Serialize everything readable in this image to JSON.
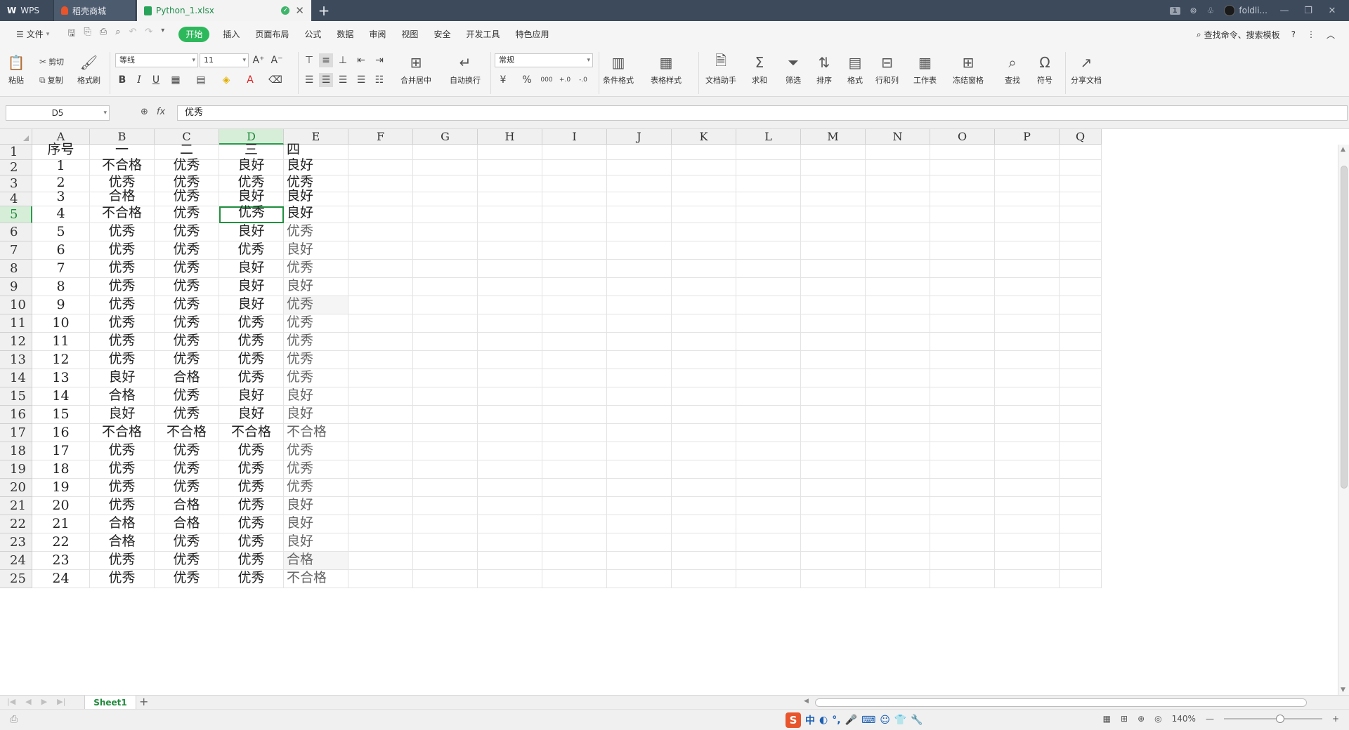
{
  "titlebar": {
    "tabs": [
      {
        "label": "WPS",
        "icon": "wps-logo-icon"
      },
      {
        "label": "稻壳商城",
        "icon": "docer-flame-icon"
      },
      {
        "label": "Python_1.xlsx",
        "icon": "spreadsheet-icon",
        "active": true
      }
    ],
    "new_tab": "+",
    "badge": "1",
    "user": "foldli...",
    "win_buttons": [
      "—",
      "❐",
      "✕"
    ]
  },
  "menubar": {
    "file": "文件",
    "items": [
      "开始",
      "插入",
      "页面布局",
      "公式",
      "数据",
      "审阅",
      "视图",
      "安全",
      "开发工具",
      "特色应用"
    ],
    "active": "开始",
    "search": "查找命令、搜索模板",
    "help": "?",
    "more": "⋮",
    "collapse": "︿"
  },
  "ribbon": {
    "paste": "粘贴",
    "cut": "剪切",
    "copy": "复制",
    "format_painter": "格式刷",
    "font_name": "等线",
    "font_size": "11",
    "grow": "A⁺",
    "shrink": "A⁻",
    "bold": "B",
    "italic": "I",
    "underline": "U",
    "merge_center": "合并居中",
    "wrap": "自动换行",
    "number_format": "常规",
    "percent": "%",
    "thousands": "000",
    "inc_decimal": "+.0",
    "dec_decimal": "-.0",
    "cond_format": "条件格式",
    "table_style": "表格样式",
    "doc_helper": "文档助手",
    "sum": "求和",
    "filter": "筛选",
    "sort": "排序",
    "format": "格式",
    "rows_cols": "行和列",
    "worksheet": "工作表",
    "freeze": "冻结窗格",
    "find": "查找",
    "symbol": "符号",
    "share": "分享文档"
  },
  "formula": {
    "cell_ref": "D5",
    "fx": "fx",
    "value": "优秀"
  },
  "grid": {
    "columns": [
      "A",
      "B",
      "C",
      "D",
      "E",
      "F",
      "G",
      "H",
      "I",
      "J",
      "K",
      "L",
      "M",
      "N",
      "O",
      "P",
      "Q"
    ],
    "selected_column": "D",
    "selected_row": 5,
    "rows": [
      {
        "n": "1",
        "cells": [
          "序号",
          "一",
          "二",
          "三",
          "四"
        ]
      },
      {
        "n": "2",
        "cells": [
          "1",
          "不合格",
          "优秀",
          "良好",
          "良好"
        ]
      },
      {
        "n": "3",
        "cells": [
          "2",
          "优秀",
          "优秀",
          "优秀",
          "优秀"
        ]
      },
      {
        "n": "4",
        "cells": [
          "3",
          "合格",
          "优秀",
          "良好",
          "良好"
        ]
      },
      {
        "n": "5",
        "cells": [
          "4",
          "不合格",
          "优秀",
          "优秀",
          "良好"
        ]
      },
      {
        "n": "6",
        "cells": [
          "5",
          "优秀",
          "优秀",
          "良好",
          "优秀"
        ]
      },
      {
        "n": "7",
        "cells": [
          "6",
          "优秀",
          "优秀",
          "优秀",
          "良好"
        ]
      },
      {
        "n": "8",
        "cells": [
          "7",
          "优秀",
          "优秀",
          "良好",
          "优秀"
        ]
      },
      {
        "n": "9",
        "cells": [
          "8",
          "优秀",
          "优秀",
          "良好",
          "良好"
        ]
      },
      {
        "n": "10",
        "cells": [
          "9",
          "优秀",
          "优秀",
          "良好",
          "优秀"
        ]
      },
      {
        "n": "11",
        "cells": [
          "10",
          "优秀",
          "优秀",
          "优秀",
          "优秀"
        ]
      },
      {
        "n": "12",
        "cells": [
          "11",
          "优秀",
          "优秀",
          "优秀",
          "优秀"
        ]
      },
      {
        "n": "13",
        "cells": [
          "12",
          "优秀",
          "优秀",
          "优秀",
          "优秀"
        ]
      },
      {
        "n": "14",
        "cells": [
          "13",
          "良好",
          "合格",
          "优秀",
          "优秀"
        ]
      },
      {
        "n": "15",
        "cells": [
          "14",
          "合格",
          "优秀",
          "良好",
          "良好"
        ]
      },
      {
        "n": "16",
        "cells": [
          "15",
          "良好",
          "优秀",
          "良好",
          "良好"
        ]
      },
      {
        "n": "17",
        "cells": [
          "16",
          "不合格",
          "不合格",
          "不合格",
          "不合格"
        ]
      },
      {
        "n": "18",
        "cells": [
          "17",
          "优秀",
          "优秀",
          "优秀",
          "优秀"
        ]
      },
      {
        "n": "19",
        "cells": [
          "18",
          "优秀",
          "优秀",
          "优秀",
          "优秀"
        ]
      },
      {
        "n": "20",
        "cells": [
          "19",
          "优秀",
          "优秀",
          "优秀",
          "优秀"
        ]
      },
      {
        "n": "21",
        "cells": [
          "20",
          "优秀",
          "合格",
          "优秀",
          "良好"
        ]
      },
      {
        "n": "22",
        "cells": [
          "21",
          "合格",
          "合格",
          "优秀",
          "良好"
        ]
      },
      {
        "n": "23",
        "cells": [
          "22",
          "合格",
          "优秀",
          "优秀",
          "良好"
        ]
      },
      {
        "n": "24",
        "cells": [
          "23",
          "优秀",
          "优秀",
          "优秀",
          "合格"
        ]
      },
      {
        "n": "25",
        "cells": [
          "24",
          "优秀",
          "优秀",
          "优秀",
          "不合格"
        ]
      }
    ]
  },
  "sheets": {
    "tabs": [
      "Sheet1"
    ],
    "add": "+"
  },
  "status": {
    "zoom": "140%",
    "zoom_out": "—",
    "zoom_in": "+",
    "ime": [
      "中",
      "◐",
      "°,",
      "🎤",
      "⌨",
      "☺",
      "👕",
      "🔧"
    ]
  },
  "colors": {
    "accent_green": "#2eb85c",
    "title_bg": "#3c4a5c",
    "selection_green": "#22913f"
  }
}
